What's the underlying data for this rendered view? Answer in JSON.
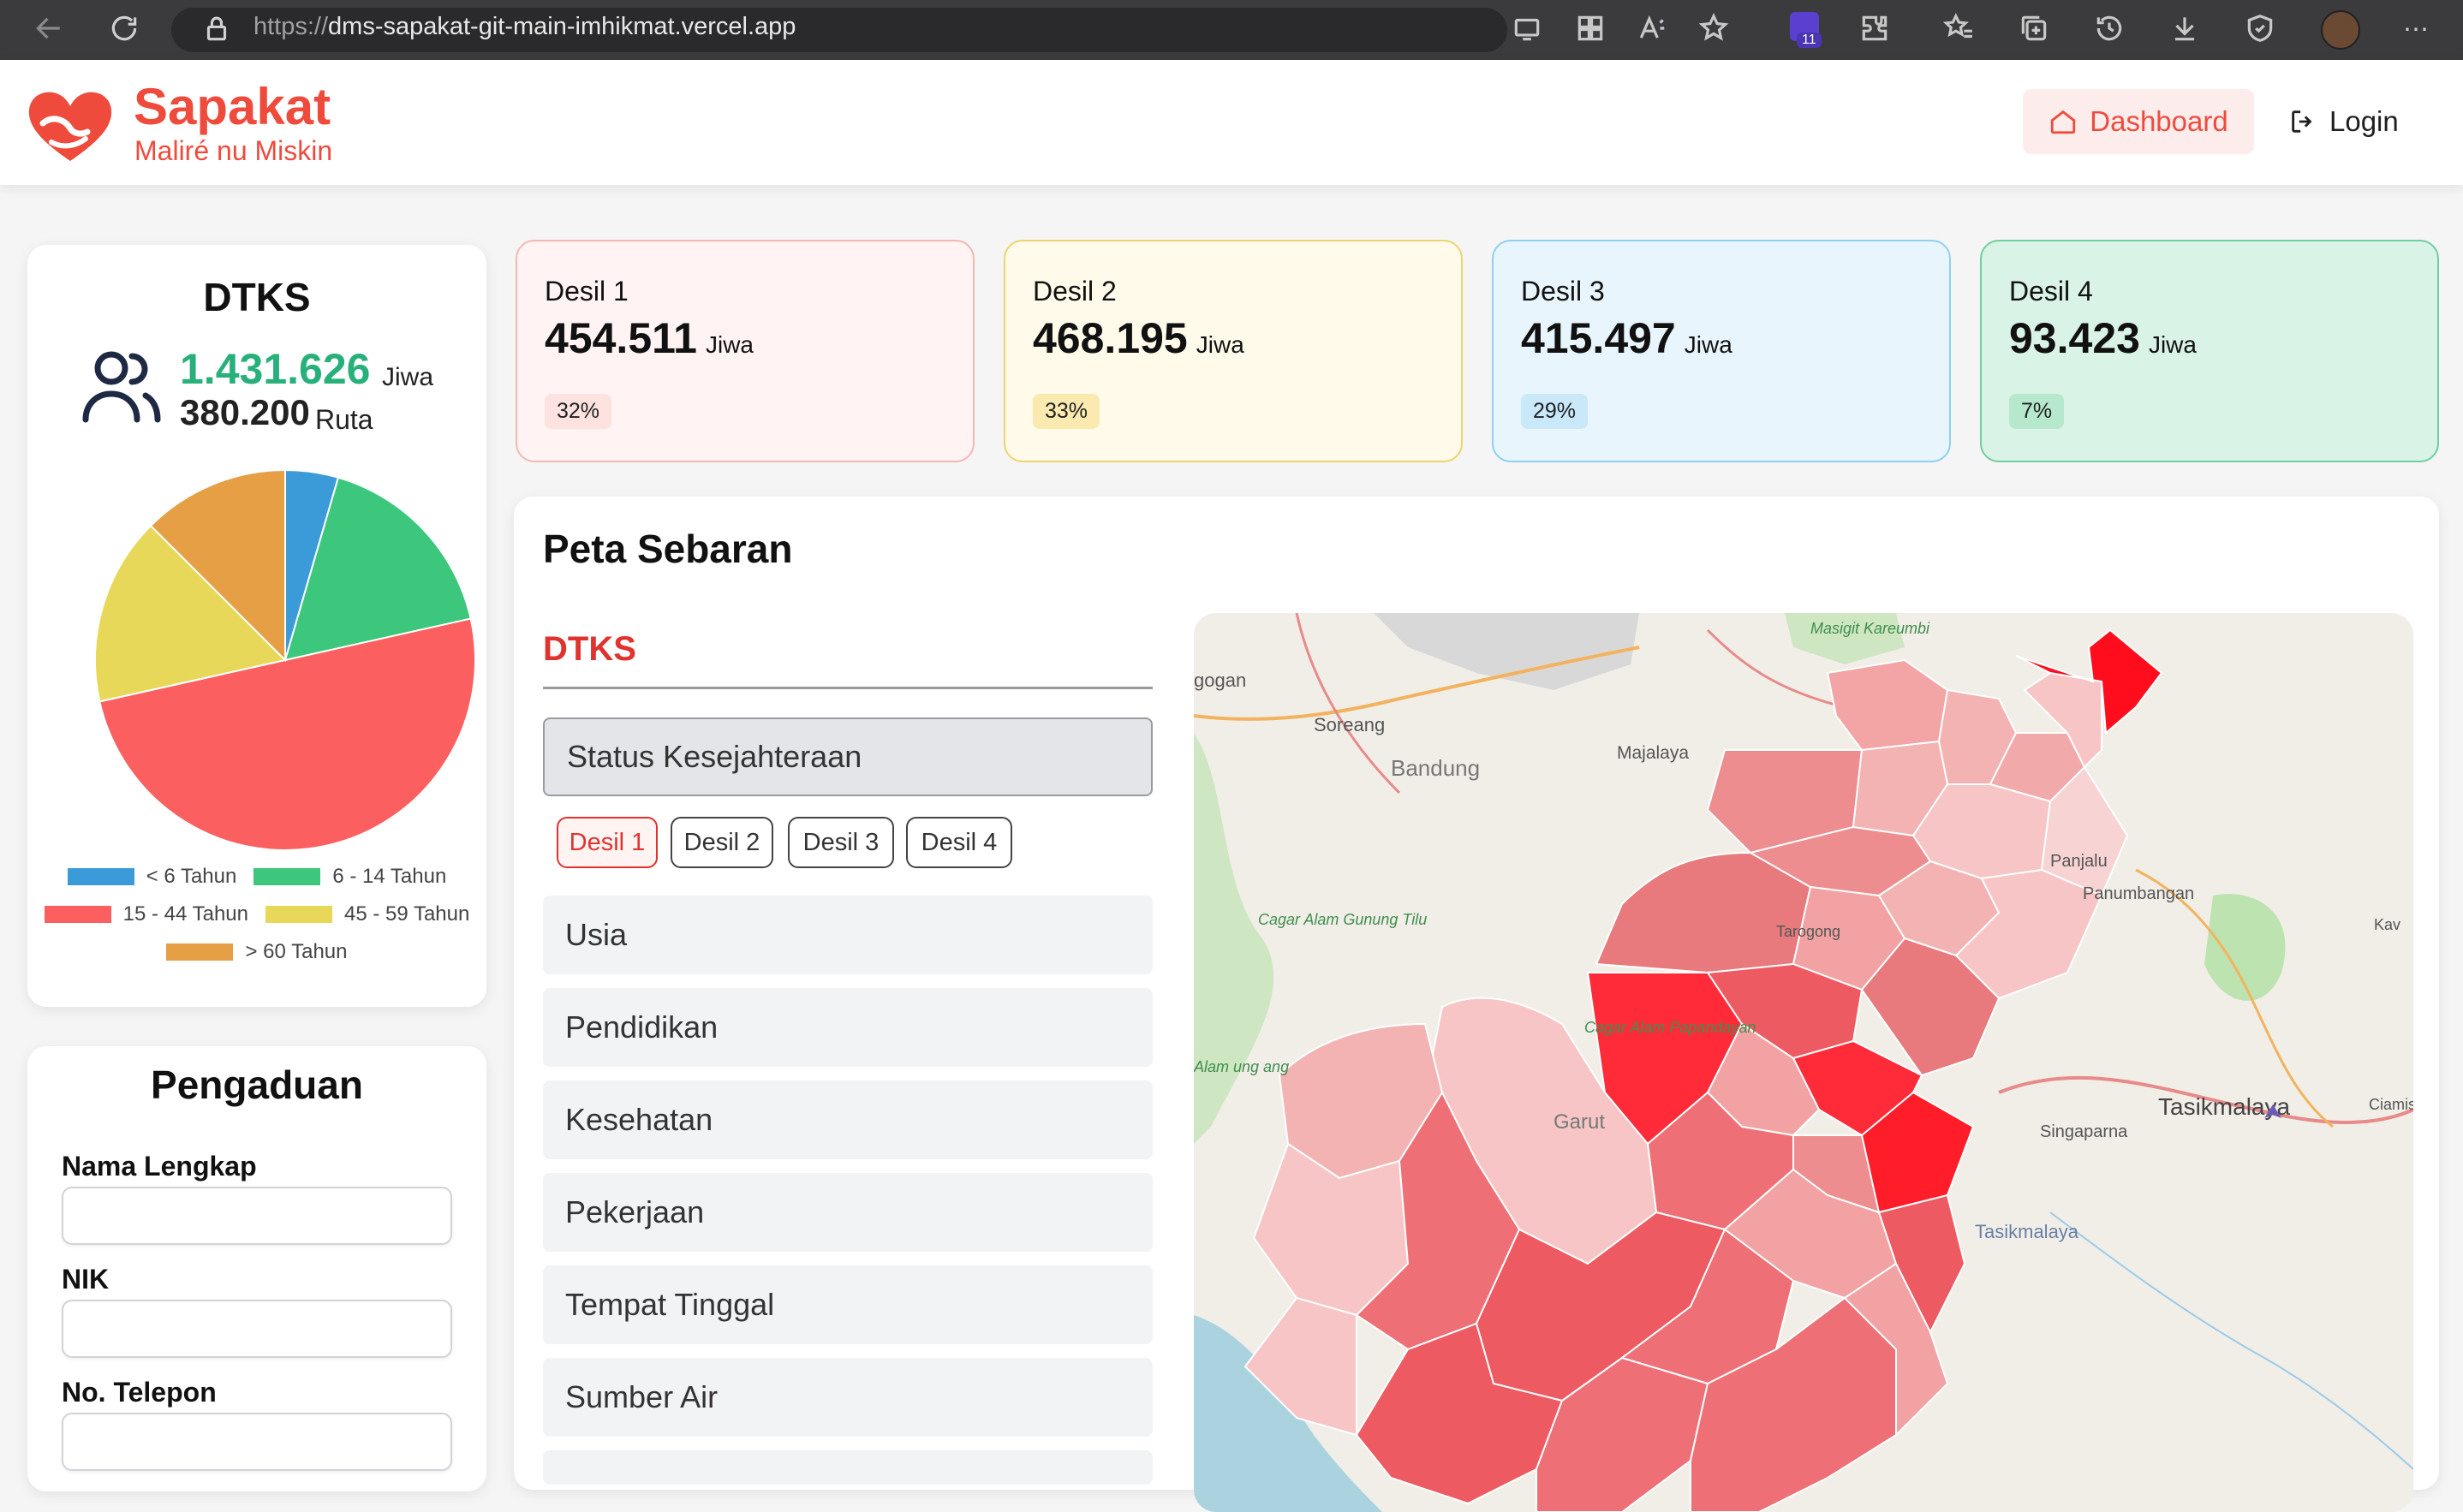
{
  "browser": {
    "url_proto": "https://",
    "url_host": "dms-sapakat-git-main-imhikmat.vercel.app",
    "extension_badge": "11"
  },
  "header": {
    "brand_name": "Sapakat",
    "brand_tagline": "Maliré nu Miskin",
    "nav_dashboard": "Dashboard",
    "nav_login": "Login",
    "accent": "#ef4b3d"
  },
  "dtks": {
    "title": "DTKS",
    "jiwa_value": "1.431.626",
    "jiwa_unit": "Jiwa",
    "ruta_value": "380.200",
    "ruta_unit": "Ruta",
    "chart_data": {
      "type": "pie",
      "labels": [
        "< 6 Tahun",
        "6 - 14 Tahun",
        "15 - 44 Tahun",
        "45 - 59 Tahun",
        "> 60 Tahun"
      ],
      "values": [
        4.5,
        17,
        50,
        16,
        12.5
      ],
      "colors": [
        "#3b9bd9",
        "#3cc77c",
        "#fb5f5f",
        "#e8d85a",
        "#e69f45"
      ]
    }
  },
  "pengaduan": {
    "title": "Pengaduan",
    "fields": [
      {
        "label": "Nama Lengkap",
        "value": ""
      },
      {
        "label": "NIK",
        "value": ""
      },
      {
        "label": "No. Telepon",
        "value": ""
      }
    ]
  },
  "desil_cards": [
    {
      "label": "Desil 1",
      "value": "454.511",
      "unit": "Jiwa",
      "percent": "32%",
      "bg": "#fff4f3",
      "border": "#f3b8b2",
      "pill": "#fde2df"
    },
    {
      "label": "Desil 2",
      "value": "468.195",
      "unit": "Jiwa",
      "percent": "33%",
      "bg": "#fffaea",
      "border": "#ecd46e",
      "pill": "#fbeab0"
    },
    {
      "label": "Desil 3",
      "value": "415.497",
      "unit": "Jiwa",
      "percent": "29%",
      "bg": "#e8f5fd",
      "border": "#8fd0ef",
      "pill": "#c9e8fa"
    },
    {
      "label": "Desil 4",
      "value": "93.423",
      "unit": "Jiwa",
      "percent": "7%",
      "bg": "#d9f3e6",
      "border": "#6fcf9e",
      "pill": "#b5e8cc"
    }
  ],
  "peta": {
    "title": "Peta Sebaran",
    "tab": "DTKS",
    "open_section": "Status Kesejahteraan",
    "desil_buttons": [
      "Desil 1",
      "Desil 2",
      "Desil 3",
      "Desil 4"
    ],
    "active_desil": "Desil 1",
    "sections": [
      "Usia",
      "Pendidikan",
      "Kesehatan",
      "Pekerjaan",
      "Tempat Tinggal",
      "Sumber Air"
    ],
    "map_labels": {
      "bandung": "Bandung",
      "soreang": "Soreang",
      "majalaya": "Majalaya",
      "masigit": "Masigit Kareumbi",
      "garut": "Garut",
      "tarogong": "Tarogong",
      "panjalu": "Panjalu",
      "panumbangan": "Panumbangan",
      "tasikmalaya": "Tasikmalaya",
      "tasikmalaya_kab": "Tasikmalaya",
      "singaparna": "Singaparna",
      "cagar_gunung_tilu": "Cagar Alam Gunung Tilu",
      "cagar_papandayan": "Cagar Alam Papandayan",
      "ciamis": "Ciamis",
      "kawali": "Kav",
      "edge_left": "gogan",
      "edge_alam": "Alam ung ang"
    }
  }
}
